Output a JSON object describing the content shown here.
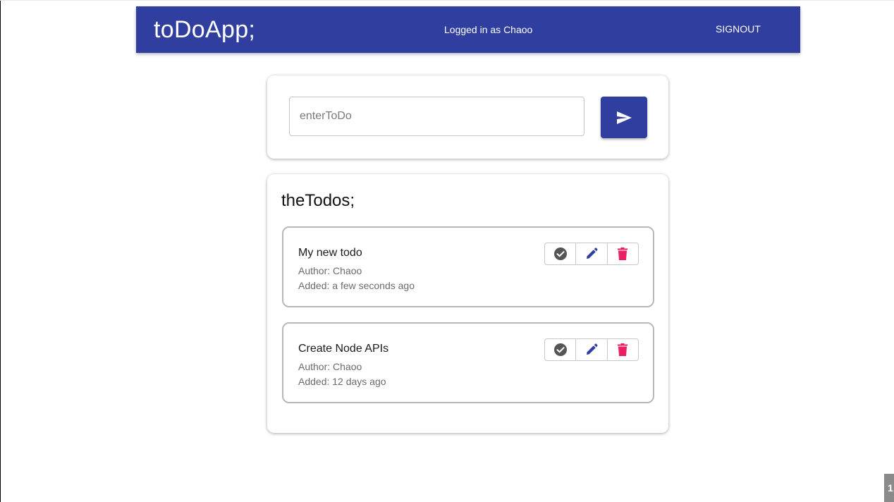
{
  "app": {
    "brand": "toDoApp;",
    "logged_in_text": "Logged in as Chaoo",
    "signout_label": "SIGNOUT"
  },
  "composer": {
    "placeholder": "enterToDo",
    "value": "",
    "send_icon": "send-icon"
  },
  "list": {
    "title": "theTodos;",
    "items": [
      {
        "text": "My new todo",
        "author": "Author: Chaoo",
        "added": "Added: a few seconds ago"
      },
      {
        "text": "Create Node APIs",
        "author": "Author: Chaoo",
        "added": "Added: 12 days ago"
      }
    ],
    "actions": [
      "check-circle-icon",
      "pencil-icon",
      "trash-icon"
    ]
  },
  "corner_badge": "1",
  "colors": {
    "primary": "#303f9f",
    "delete": "#e91e63",
    "check": "#555555",
    "edit": "#303f9f"
  }
}
